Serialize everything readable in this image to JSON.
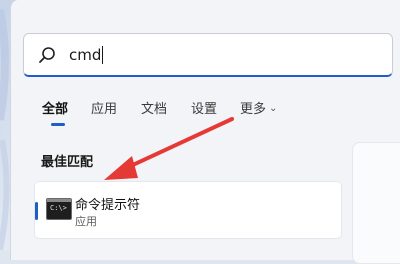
{
  "search": {
    "query": "cmd"
  },
  "tabs": [
    {
      "label": "全部",
      "active": true
    },
    {
      "label": "应用",
      "active": false
    },
    {
      "label": "文档",
      "active": false
    },
    {
      "label": "设置",
      "active": false
    },
    {
      "label": "更多",
      "active": false
    }
  ],
  "best_match": {
    "heading": "最佳匹配",
    "result": {
      "title": "命令提示符",
      "subtitle": "应用",
      "icon": "cmd-prompt-icon",
      "prompt_glyph": "C:\\>"
    }
  },
  "colors": {
    "accent": "#1f5fc4",
    "annotation_arrow": "#e53935"
  },
  "icons": {
    "search": "search-icon",
    "more": "chevron-down-icon"
  }
}
